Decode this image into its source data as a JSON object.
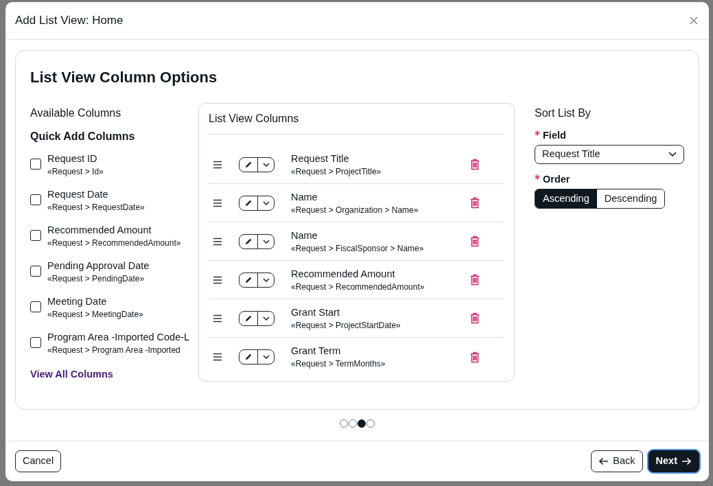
{
  "dialog": {
    "title": "Add List View: Home"
  },
  "section_title": "List View Column Options",
  "available": {
    "heading": "Available Columns",
    "subheading": "Quick Add Columns",
    "items": [
      {
        "label": "Request ID",
        "path": "«Request > Id»",
        "checked": false
      },
      {
        "label": "Request Date",
        "path": "«Request > RequestDate»",
        "checked": false
      },
      {
        "label": "Recommended Amount",
        "path": "«Request > RecommendedAmount»",
        "checked": false
      },
      {
        "label": "Pending Approval Date",
        "path": "«Request > PendingDate»",
        "checked": false
      },
      {
        "label": "Meeting Date",
        "path": "«Request > MeetingDate»",
        "checked": false
      },
      {
        "label": "Program Area -Imported Code-L",
        "path": "«Request > Program Area -Imported",
        "checked": false
      }
    ],
    "link": "View All Columns"
  },
  "list_view_columns": {
    "heading": "List View Columns",
    "rows": [
      {
        "title": "Request Title",
        "path": "«Request > ProjectTitle»"
      },
      {
        "title": "Name",
        "path": "«Request > Organization > Name»"
      },
      {
        "title": "Name",
        "path": "«Request > FiscalSponsor > Name»"
      },
      {
        "title": "Recommended Amount",
        "path": "«Request > RecommendedAmount»"
      },
      {
        "title": "Grant Start",
        "path": "«Request > ProjectStartDate»"
      },
      {
        "title": "Grant Term",
        "path": "«Request > TermMonths»"
      }
    ]
  },
  "sort": {
    "heading": "Sort List By",
    "field_label": "Field",
    "field_required": true,
    "field_value": "Request Title",
    "order_label": "Order",
    "order_required": true,
    "options": [
      {
        "label": "Ascending",
        "selected": true
      },
      {
        "label": "Descending",
        "selected": false
      }
    ]
  },
  "steps": [
    {
      "selected": false
    },
    {
      "selected": false
    },
    {
      "selected": true
    },
    {
      "selected": false
    }
  ],
  "footer": {
    "cancel": "Cancel",
    "back": "Back",
    "next": "Next"
  }
}
